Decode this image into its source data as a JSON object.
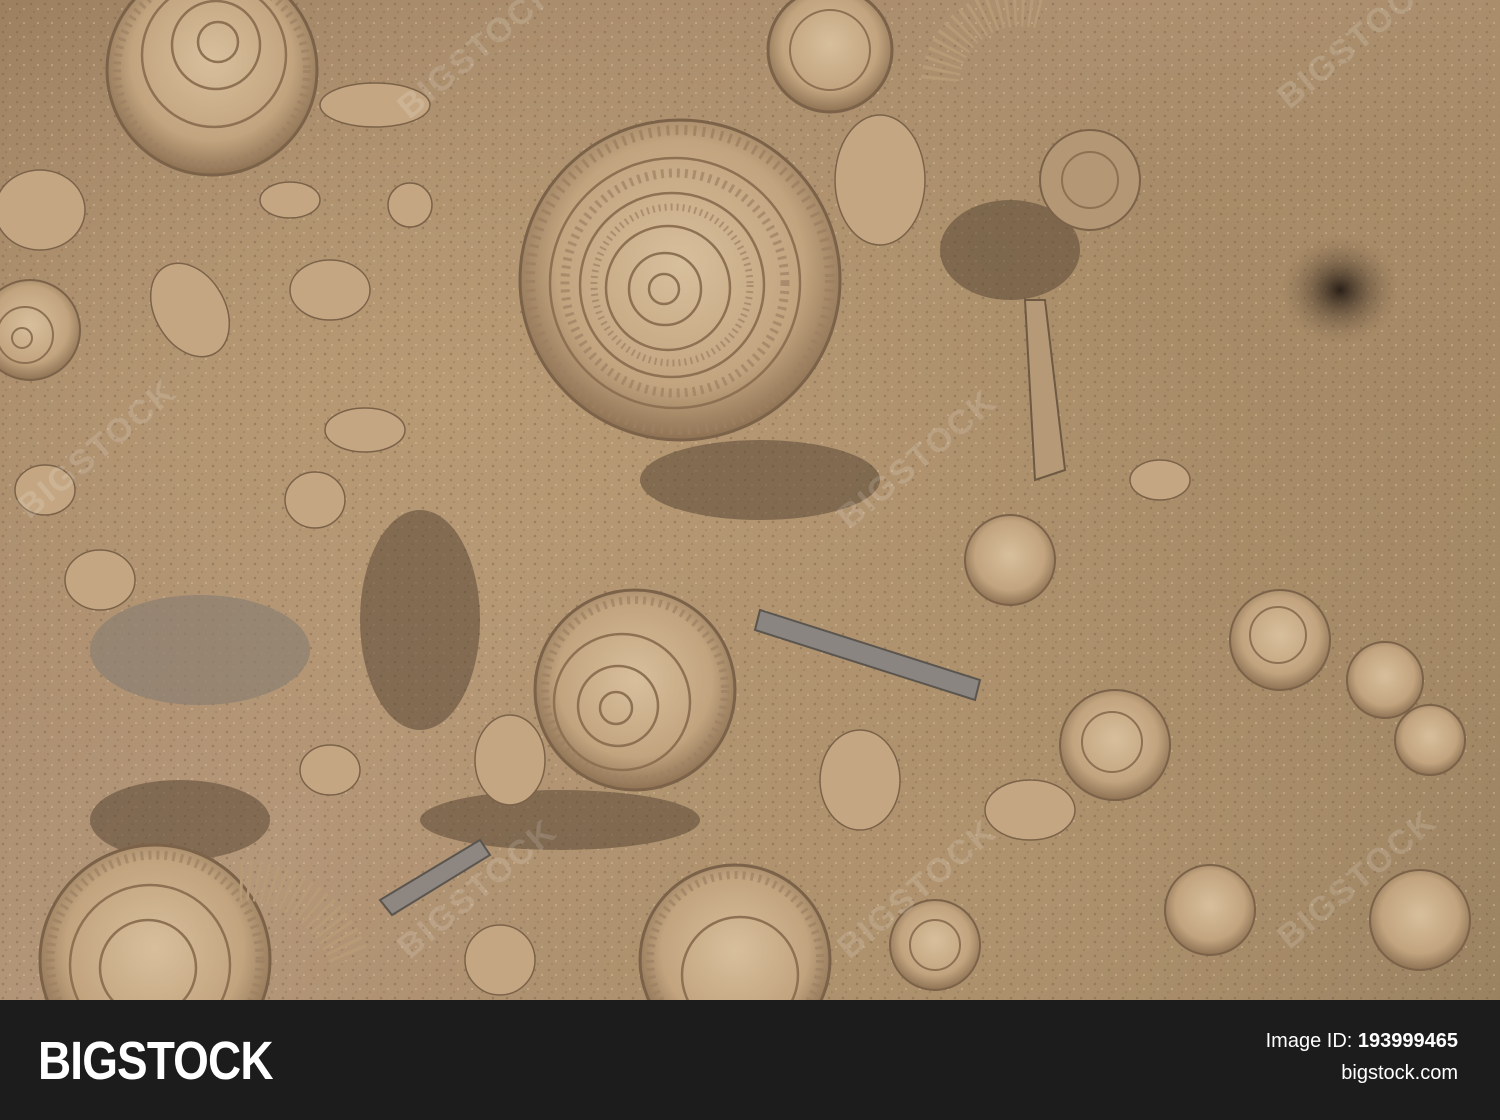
{
  "photo": {
    "subject": "ammonite-fossils",
    "palette": {
      "rock_light": "#c9ad88",
      "rock_mid": "#a98c69",
      "rock_dark": "#6e5942",
      "shadow": "#3d2f22"
    },
    "watermark_text": "BIGSTOCK"
  },
  "footer": {
    "brand": "BIGSTOCK",
    "image_id_label": "Image ID:",
    "image_id": "193999465",
    "site": "bigstock.com",
    "background": "#1c1c1c"
  }
}
